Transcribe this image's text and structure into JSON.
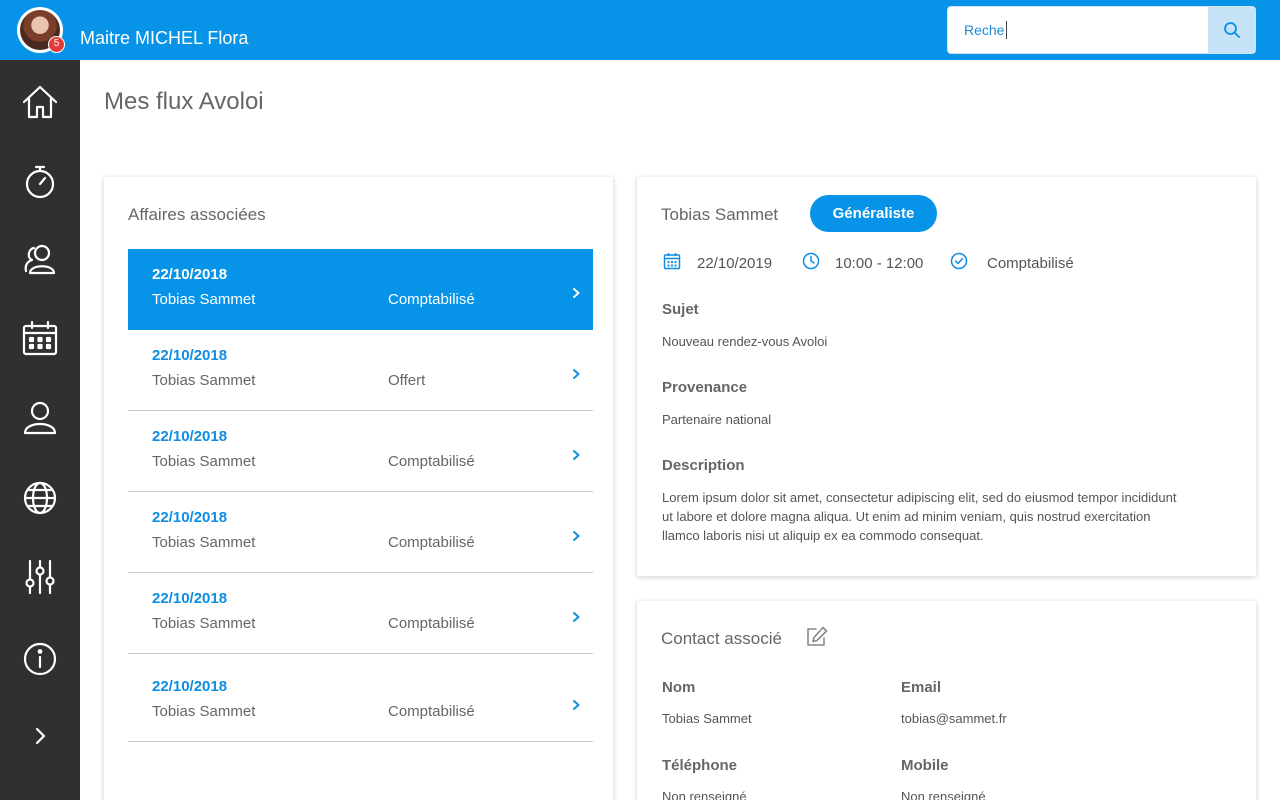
{
  "header": {
    "user_name": "Maitre MICHEL Flora",
    "notification_count": "5",
    "search_value": "Reche",
    "accent_color": "#0793e8"
  },
  "sidebar": {
    "items": [
      {
        "icon": "home-icon"
      },
      {
        "icon": "stopwatch-icon"
      },
      {
        "icon": "users-icon"
      },
      {
        "icon": "calendar-icon"
      },
      {
        "icon": "user-icon"
      },
      {
        "icon": "globe-icon"
      },
      {
        "icon": "sliders-icon"
      },
      {
        "icon": "info-icon"
      },
      {
        "icon": "chevron-right-icon"
      }
    ]
  },
  "page": {
    "title": "Mes flux Avoloi"
  },
  "affaires": {
    "title": "Affaires associées",
    "rows": [
      {
        "date": "22/10/2018",
        "person": "Tobias Sammet",
        "status": "Comptabilisé",
        "active": true
      },
      {
        "date": "22/10/2018",
        "person": "Tobias Sammet",
        "status": "Offert",
        "active": false
      },
      {
        "date": "22/10/2018",
        "person": "Tobias Sammet",
        "status": "Comptabilisé",
        "active": false
      },
      {
        "date": "22/10/2018",
        "person": "Tobias Sammet",
        "status": "Comptabilisé",
        "active": false
      },
      {
        "date": "22/10/2018",
        "person": "Tobias Sammet",
        "status": "Comptabilisé",
        "active": false
      },
      {
        "date": "22/10/2018",
        "person": "Tobias Sammet",
        "status": "Comptabilisé",
        "active": false
      }
    ]
  },
  "detail": {
    "name": "Tobias Sammet",
    "tag": "Généraliste",
    "date": "22/10/2019",
    "time": "10:00 - 12:00",
    "status": "Comptabilisé",
    "subject_label": "Sujet",
    "subject": "Nouveau rendez-vous Avoloi",
    "origin_label": "Provenance",
    "origin": "Partenaire national",
    "description_label": "Description",
    "description_lines": [
      "Lorem ipsum dolor sit amet, consectetur adipiscing elit, sed do eiusmod tempor incididunt",
      "ut labore et dolore magna aliqua. Ut enim ad minim veniam, quis nostrud exercitation",
      "llamco laboris nisi ut aliquip ex ea commodo consequat."
    ]
  },
  "contact": {
    "title": "Contact associé",
    "name_label": "Nom",
    "name": "Tobias Sammet",
    "email_label": "Email",
    "email": "tobias@sammet.fr",
    "phone_label": "Téléphone",
    "phone": "Non renseigné",
    "mobile_label": "Mobile",
    "mobile": "Non renseigné"
  }
}
